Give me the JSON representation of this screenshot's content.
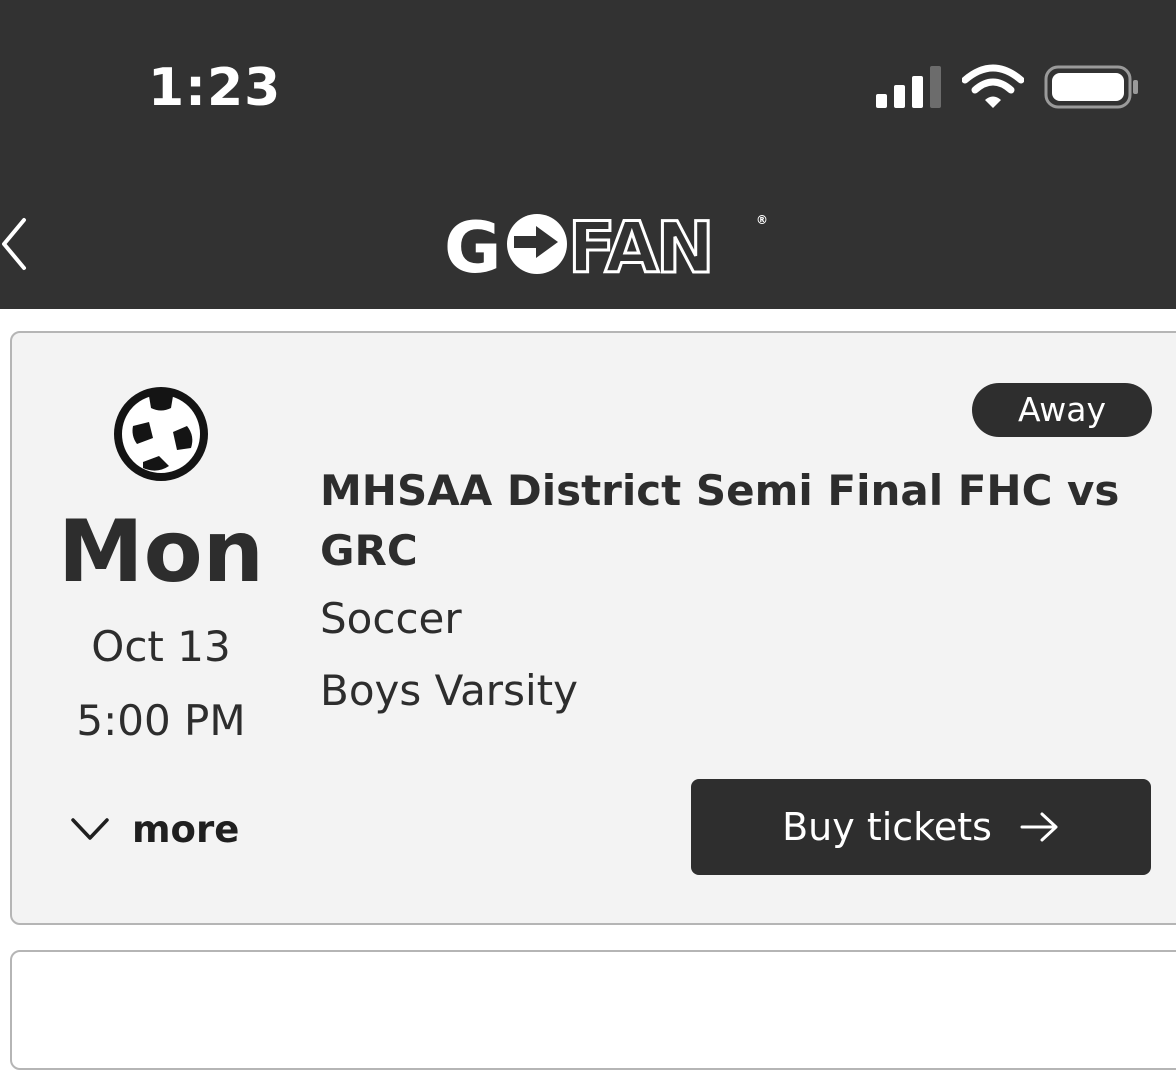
{
  "status_bar": {
    "time": "1:23",
    "icons": [
      "cellular-signal-icon",
      "wifi-icon",
      "battery-icon"
    ]
  },
  "header": {
    "back_icon": "chevron-left-icon",
    "logo_text": "GOFAN",
    "logo_mark": "®"
  },
  "event": {
    "sport_icon": "soccer-ball-icon",
    "day": "Mon",
    "date": "Oct 13",
    "time": "5:00 PM",
    "badge": "Away",
    "title": "MHSAA District Semi Final FHC vs GRC",
    "sport": "Soccer",
    "level": "Boys Varsity",
    "more_label": "more",
    "buy_label": "Buy tickets"
  },
  "colors": {
    "header_bg": "#323232",
    "card_bg": "#f3f3f3",
    "card_border": "#b5b5b5",
    "button_bg": "#2e2e2e",
    "text_dark": "#2d2d2d"
  }
}
